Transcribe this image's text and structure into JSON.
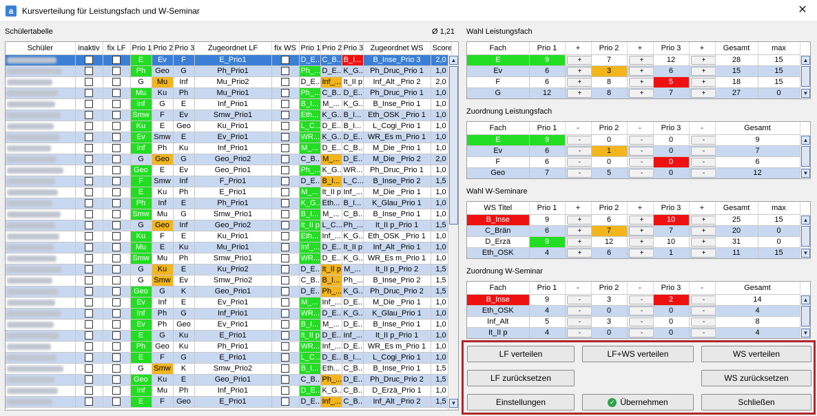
{
  "window": {
    "title": "Kursverteilung für Leistungsfach und W-Seminar",
    "close": "✕",
    "icon": "a"
  },
  "left": {
    "label": "Schülertabelle",
    "avg": "Ø 1,21",
    "headers": [
      "Schüler",
      "inaktiv",
      "fix LF",
      "Prio 1",
      "Prio 2",
      "Prio 3",
      "Zugeordnet LF",
      "fix WS",
      "Prio 1",
      "Prio 2",
      "Prio 3",
      "Zugeordnet WS",
      "Score"
    ],
    "rows": [
      [
        "E",
        "Ev",
        "F",
        "E_Prio1",
        "D_E...",
        "C_B...",
        "B_I...",
        "B_Inse_Prio 3",
        "2,0"
      ],
      [
        "Ph",
        "Geo",
        "G",
        "Ph_Prio1",
        "Ph_...",
        "D_E...",
        "K_G...",
        "Ph_Druc_Prio 1",
        "1,0"
      ],
      [
        "G",
        "Mu",
        "Inf",
        "Mu_Prio2",
        "D_E...",
        "Inf_...",
        "It_II p",
        "Inf_Alt _Prio 2",
        "2,0"
      ],
      [
        "Mu",
        "Ku",
        "Ph",
        "Mu_Prio1",
        "Ph_...",
        "C_B...",
        "D_E...",
        "Ph_Druc_Prio 1",
        "1,0"
      ],
      [
        "Inf",
        "G",
        "E",
        "Inf_Prio1",
        "B_I...",
        "M_...",
        "K_G...",
        "B_Inse_Prio 1",
        "1,0"
      ],
      [
        "Smw",
        "F",
        "Ev",
        "Smw_Prio1",
        "Eth...",
        "K_G...",
        "B_I...",
        "Eth_OSK _Prio 1",
        "1,0"
      ],
      [
        "Ku",
        "E",
        "Geo",
        "Ku_Prio1",
        "L_C...",
        "D_E...",
        "B_I...",
        "L_Cogi_Prio 1",
        "1,0"
      ],
      [
        "Ev",
        "Smw",
        "E",
        "Ev_Prio1",
        "WR...",
        "K_G...",
        "D_E...",
        "WR_Es m_Prio 1",
        "1,0"
      ],
      [
        "Inf",
        "Ph",
        "Ku",
        "Inf_Prio1",
        "M_...",
        "D_E...",
        "C_B...",
        "M_Die _Prio 1",
        "1,0"
      ],
      [
        "G",
        "Geo",
        "G",
        "Geo_Prio2",
        "C_B...",
        "M_...",
        "D_E...",
        "M_Die _Prio 2",
        "2,0"
      ],
      [
        "Geo",
        "E",
        "Ev",
        "Geo_Prio1",
        "Ph_...",
        "K_G...",
        "WR...",
        "Ph_Druc_Prio 1",
        "1,0"
      ],
      [
        "F",
        "Smw",
        "Inf",
        "F_Prio1",
        "D_E...",
        "B_I...",
        "L_C...",
        "B_Inse_Prio 2",
        "1,5"
      ],
      [
        "E",
        "Ku",
        "Ph",
        "E_Prio1",
        "M_...",
        "It_II p",
        "Inf_...",
        "M_Die _Prio 1",
        "1,0"
      ],
      [
        "Ph",
        "Inf",
        "E",
        "Ph_Prio1",
        "K_G...",
        "Eth...",
        "B_I...",
        "K_Glau_Prio 1",
        "1,0"
      ],
      [
        "Smw",
        "Mu",
        "G",
        "Smw_Prio1",
        "B_I...",
        "M_...",
        "C_B...",
        "B_Inse_Prio 1",
        "1,0"
      ],
      [
        "G",
        "Geo",
        "Inf",
        "Geo_Prio2",
        "It_II p",
        "L_C...",
        "Ph_...",
        "It_II p_Prio 1",
        "1,5"
      ],
      [
        "Ku",
        "F",
        "E",
        "Ku_Prio1",
        "Eth...",
        "Inf_...",
        "K_G...",
        "Eth_OSK _Prio 1",
        "1,0"
      ],
      [
        "Mu",
        "E",
        "Ku",
        "Mu_Prio1",
        "Inf_...",
        "D_E...",
        "It_II p",
        "Inf_Alt _Prio 1",
        "1,0"
      ],
      [
        "Smw",
        "Mu",
        "Ph",
        "Smw_Prio1",
        "WR...",
        "D_E...",
        "K_G...",
        "WR_Es m_Prio 1",
        "1,0"
      ],
      [
        "G",
        "Ku",
        "E",
        "Ku_Prio2",
        "D_E...",
        "It_II p",
        "M_...",
        "It_II p_Prio 2",
        "1,5"
      ],
      [
        "G",
        "Smw",
        "Ev",
        "Smw_Prio2",
        "C_B...",
        "B_I...",
        "Ph_...",
        "B_Inse_Prio 2",
        "1,5"
      ],
      [
        "Geo",
        "G",
        "K",
        "Geo_Prio1",
        "D_E...",
        "Ph_...",
        "K_G...",
        "Ph_Druc_Prio 2",
        "1,5"
      ],
      [
        "Ev",
        "Inf",
        "E",
        "Ev_Prio1",
        "M_...",
        "Inf_...",
        "D_E...",
        "M_Die _Prio 1",
        "1,0"
      ],
      [
        "Inf",
        "Ph",
        "G",
        "Inf_Prio1",
        "WR...",
        "D_E...",
        "K_G...",
        "K_Glau_Prio 1",
        "1,0"
      ],
      [
        "Ev",
        "Ph",
        "Geo",
        "Ev_Prio1",
        "B_I...",
        "M_...",
        "D_E...",
        "B_Inse_Prio 1",
        "1,0"
      ],
      [
        "E",
        "G",
        "Ku",
        "E_Prio1",
        "It_II p",
        "D_E...",
        "Inf_...",
        "It_II p_Prio 1",
        "1,0"
      ],
      [
        "Ph",
        "Geo",
        "Ku",
        "Ph_Prio1",
        "WR...",
        "Inf_...",
        "D_E...",
        "WR_Es m_Prio 1",
        "1,0"
      ],
      [
        "E",
        "F",
        "G",
        "E_Prio1",
        "L_C...",
        "D_E...",
        "B_I...",
        "L_Cogi_Prio 1",
        "1,0"
      ],
      [
        "G",
        "Smw",
        "K",
        "Smw_Prio2",
        "B_I...",
        "Eth...",
        "C_B...",
        "B_Inse_Prio 1",
        "1,5"
      ],
      [
        "Geo",
        "Ku",
        "E",
        "Geo_Prio1",
        "C_B...",
        "Ph_...",
        "D_E...",
        "Ph_Druc_Prio 2",
        "1,5"
      ],
      [
        "Inf",
        "Mu",
        "Ph",
        "Inf_Prio1",
        "D_E...",
        "K_G...",
        "C_B...",
        "D_Erzä_Prio 1",
        "1,0"
      ],
      [
        "E",
        "F",
        "Geo",
        "E_Prio1",
        "D_E...",
        "Inf_...",
        "C_B...",
        "Inf_Alt _Prio 2",
        "1,5"
      ]
    ]
  },
  "wahl_lf": {
    "label": "Wahl Leistungsfach",
    "headers": [
      "Fach",
      "Prio 1",
      "+",
      "Prio 2",
      "+",
      "Prio 3",
      "+",
      "Gesamt",
      "max"
    ],
    "rows": [
      [
        "E",
        "9",
        "+",
        "7",
        "+",
        "12",
        "+",
        "28",
        "15"
      ],
      [
        "Ev",
        "6",
        "+",
        "3",
        "+",
        "6",
        "+",
        "15",
        "15"
      ],
      [
        "F",
        "6",
        "+",
        "8",
        "+",
        "5",
        "+",
        "18",
        "15"
      ],
      [
        "G",
        "12",
        "+",
        "8",
        "+",
        "7",
        "+",
        "27",
        "0"
      ]
    ]
  },
  "zuord_lf": {
    "label": "Zuordnung Leistungsfach",
    "headers": [
      "Fach",
      "Prio 1",
      "-",
      "Prio 2",
      "-",
      "Prio 3",
      "-",
      "Gesamt"
    ],
    "rows": [
      [
        "E",
        "9",
        "-",
        "0",
        "-",
        "0",
        "-",
        "9"
      ],
      [
        "Ev",
        "6",
        "-",
        "1",
        "-",
        "0",
        "-",
        "7"
      ],
      [
        "F",
        "6",
        "-",
        "0",
        "-",
        "0",
        "-",
        "6"
      ],
      [
        "Geo",
        "7",
        "-",
        "5",
        "-",
        "0",
        "-",
        "12"
      ]
    ]
  },
  "wahl_ws": {
    "label": "Wahl W-Seminare",
    "headers": [
      "WS Titel",
      "Prio 1",
      "+",
      "Prio 2",
      "+",
      "Prio 3",
      "+",
      "Gesamt",
      "max"
    ],
    "rows": [
      [
        "B_Inse",
        "9",
        "+",
        "6",
        "+",
        "10",
        "+",
        "25",
        "15"
      ],
      [
        "C_Brän",
        "6",
        "+",
        "7",
        "+",
        "7",
        "+",
        "20",
        "0"
      ],
      [
        "D_Erzä",
        "9",
        "+",
        "12",
        "+",
        "10",
        "+",
        "31",
        "0"
      ],
      [
        "Eth_OSK",
        "4",
        "+",
        "6",
        "+",
        "1",
        "+",
        "11",
        "15"
      ]
    ]
  },
  "zuord_ws": {
    "label": "Zuordnung W-Seminar",
    "headers": [
      "Fach",
      "Prio 1",
      "-",
      "Prio 2",
      "-",
      "Prio 3",
      "-",
      "Gesamt"
    ],
    "rows": [
      [
        "B_Inse",
        "9",
        "-",
        "3",
        "-",
        "2",
        "-",
        "14"
      ],
      [
        "Eth_OSK",
        "4",
        "-",
        "0",
        "-",
        "0",
        "-",
        "4"
      ],
      [
        "Inf_Alt",
        "5",
        "-",
        "3",
        "-",
        "0",
        "-",
        "8"
      ],
      [
        "It_II p",
        "4",
        "-",
        "0",
        "-",
        "0",
        "-",
        "4"
      ]
    ]
  },
  "buttons": {
    "lf_verteilen": "LF verteilen",
    "lf_ws_verteilen": "LF+WS verteilen",
    "ws_verteilen": "WS verteilen",
    "lf_reset": "LF zurücksetzen",
    "ws_reset": "WS zurücksetzen",
    "settings": "Einstellungen",
    "accept": "Übernehmen",
    "close": "Schließen"
  },
  "colors": {
    "green": "#22dd22",
    "yellow": "#f2b51e",
    "red": "#ee1111",
    "selected": "#3a7fd5",
    "accent_border": "#b0262a"
  }
}
